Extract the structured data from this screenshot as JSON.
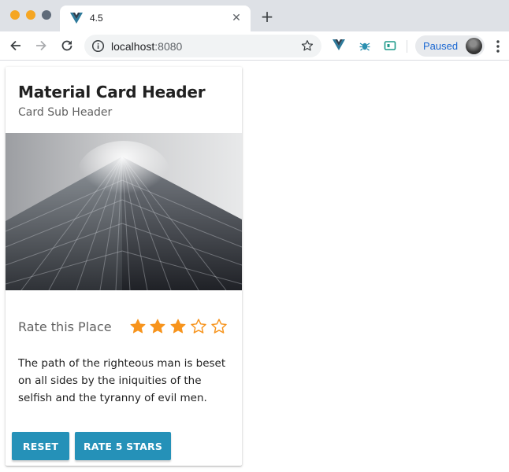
{
  "browser": {
    "tab": {
      "title": "4.5",
      "close_icon": "close-icon",
      "favicon": "vue-logo-icon"
    },
    "new_tab_label": "+",
    "url_host": "localhost",
    "url_port": ":8080",
    "profile_label": "Paused",
    "icons": [
      "back-icon",
      "forward-icon",
      "reload-icon",
      "info-icon",
      "bookmark-star-icon",
      "vue-devtools-icon",
      "bug-extension-icon",
      "tag-extension-icon",
      "menu-icon"
    ]
  },
  "card": {
    "title": "Material Card Header",
    "subtitle": "Card Sub Header",
    "rating": {
      "label": "Rate this Place",
      "value": 3,
      "max": 5,
      "color": "#f7941d"
    },
    "body": "The path of the righteous man is beset on all sides by the iniquities of the selfish and the tyranny of evil men.",
    "buttons": {
      "reset_label": "Reset",
      "rate_label": "Rate 5 Stars"
    },
    "button_color": "#2591b8"
  }
}
